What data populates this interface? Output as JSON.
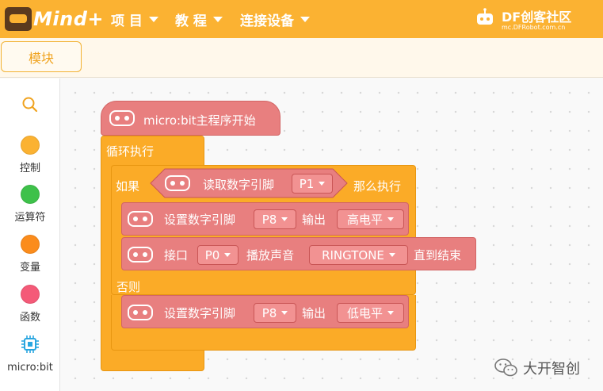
{
  "app": {
    "logo_text": "Mind+",
    "menu": [
      {
        "label": "项 目"
      },
      {
        "label": "教 程"
      },
      {
        "label": "连接设备"
      }
    ],
    "brand": {
      "title": "DF创客社区",
      "subtitle": "mc.DFRobot.com.cn"
    }
  },
  "toolbar": {
    "module_tab": "模块"
  },
  "sidebar": {
    "items": [
      {
        "label": "控制",
        "color": "#fbb232"
      },
      {
        "label": "运算符",
        "color": "#3ec14a"
      },
      {
        "label": "变量",
        "color": "#fb8c1c"
      },
      {
        "label": "函数",
        "color": "#f45a78"
      },
      {
        "label": "micro:bit",
        "color": "#2aa7e0",
        "icon": "chip-icon"
      }
    ]
  },
  "blocks": {
    "hat": "micro:bit主程序开始",
    "loop": "循环执行",
    "if": "如果",
    "then": "那么执行",
    "else": "否则",
    "read_pin": "读取数字引脚",
    "read_pin_value": "P1",
    "set_pin_1": "设置数字引脚",
    "set_pin_1_value": "P8",
    "output_1": "输出",
    "output_1_value": "高电平",
    "port": "接口",
    "port_value": "P0",
    "play": "播放声音",
    "play_value": "RINGTONE",
    "until": "直到结束",
    "set_pin_2": "设置数字引脚",
    "set_pin_2_value": "P8",
    "output_2": "输出",
    "output_2_value": "低电平"
  },
  "watermark": {
    "label": "大开智创"
  }
}
